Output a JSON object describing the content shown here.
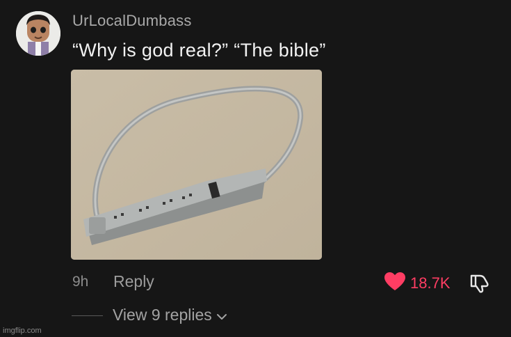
{
  "comment": {
    "username": "UrLocalDumbass",
    "text": "“Why is god real?” “The bible”",
    "time": "9h",
    "reply_label": "Reply",
    "like_count": "18.7K",
    "view_replies_label": "View 9 replies"
  },
  "icons": {
    "like": "heart-icon",
    "dislike": "thumbs-down-icon",
    "expand": "chevron-down-icon"
  },
  "colors": {
    "background": "#161616",
    "like_accent": "#ff3d63"
  },
  "watermark": "imgflip.com"
}
